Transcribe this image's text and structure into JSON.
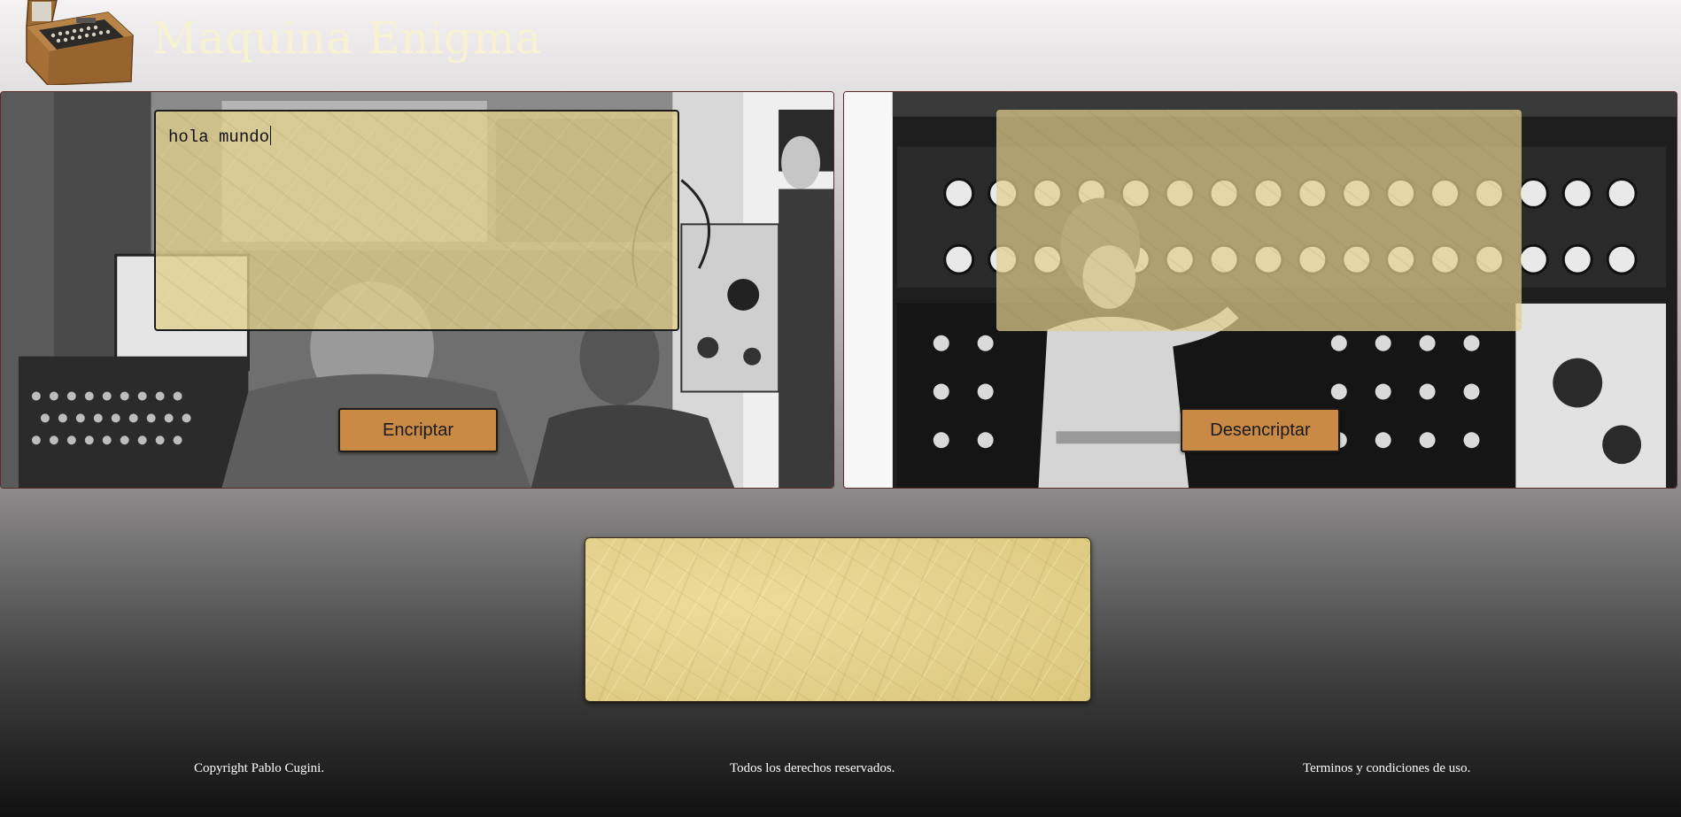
{
  "header": {
    "title": "Maquina Enigma",
    "logo_icon": "enigma-machine-icon"
  },
  "encrypt_panel": {
    "input_value": "hola mundo",
    "button_label": "Encriptar",
    "background": "enigma-operators-photo"
  },
  "decrypt_panel": {
    "input_value": "",
    "button_label": "Desencriptar",
    "background": "bombe-machine-photo"
  },
  "output": {
    "value": ""
  },
  "footer": {
    "copyright": "Copyright Pablo Cugini.",
    "rights": "Todos los derechos reservados.",
    "terms": "Terminos y condiciones de uso."
  },
  "colors": {
    "title": "#f7f2d2",
    "button": "#c98a45",
    "paper": "#e2cf89",
    "footer_text": "#ffffff"
  }
}
